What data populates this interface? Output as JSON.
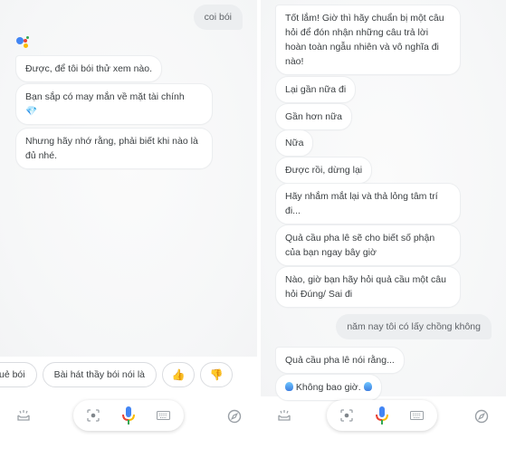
{
  "left_screen": {
    "user_message": "coi bói",
    "assistant_messages": [
      "Được, để tôi bói thử xem nào.",
      "Bạn sắp có may mắn về mặt tài chính",
      "Nhưng hãy nhớ rằng, phải biết khi nào là đủ nhé."
    ],
    "gem_emoji": "💎",
    "suggestion_chips": [
      {
        "label": "uẻ bói"
      },
      {
        "label": "Bài hát thầy bói nói là"
      },
      {
        "label": "👍",
        "icon": "thumbs-up-icon"
      },
      {
        "label": "👎",
        "icon": "thumbs-down-icon"
      }
    ]
  },
  "right_screen": {
    "assistant_messages_top": [
      "Tốt lắm! Giờ thì hãy chuẩn bị một câu hỏi để đón nhận những câu trả lời hoàn toàn ngẫu nhiên và vô nghĩa đi nào!",
      "Lại gần nữa đi",
      "Gần hơn nữa",
      "Nữa",
      "Được rồi, dừng lại",
      "Hãy nhắm mắt lại và thả lỏng tâm trí đi...",
      "Quả cầu pha lê sẽ cho biết số phận của bạn ngay bây giờ",
      "Nào, giờ bạn hãy hỏi quả cầu một câu hỏi Đúng/ Sai đi"
    ],
    "user_message": "năm nay tôi có lấy chồng không",
    "assistant_messages_bottom": [
      "Quả cầu pha lê nói rằng...",
      "Không bao giờ."
    ]
  },
  "bottom_bar": {
    "icons": [
      "snapshot-icon",
      "lens-icon",
      "mic-icon",
      "keyboard-icon",
      "compass-icon"
    ]
  },
  "colors": {
    "google_blue": "#4285f4",
    "google_red": "#ea4335",
    "google_yellow": "#fbbc05",
    "google_green": "#34a853",
    "bubble_user_bg": "#eceef0",
    "text": "#3c4043"
  }
}
